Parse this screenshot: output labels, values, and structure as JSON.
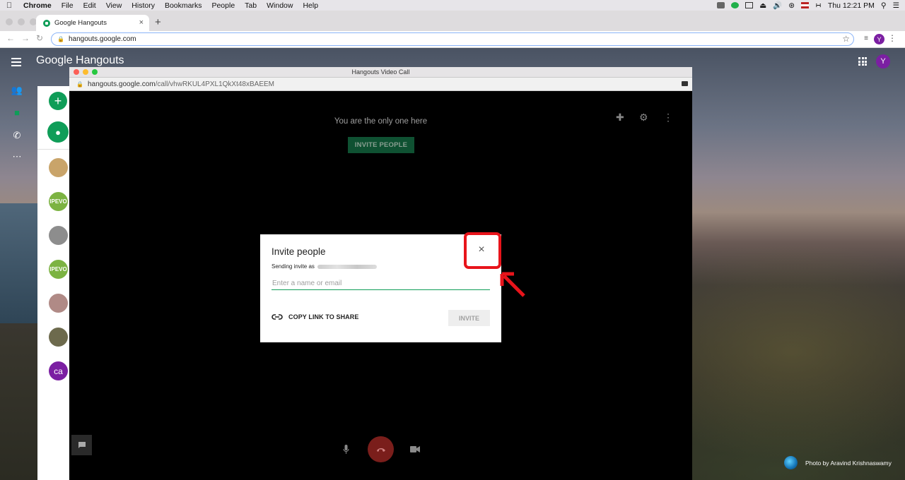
{
  "mac_menubar": {
    "app_name": "Chrome",
    "menus": [
      "File",
      "Edit",
      "View",
      "History",
      "Bookmarks",
      "People",
      "Tab",
      "Window",
      "Help"
    ],
    "clock": "Thu 12:21 PM"
  },
  "browser": {
    "tab_title": "Google Hangouts",
    "tab_close": "×",
    "new_tab": "+",
    "url": "hangouts.google.com",
    "profile_initial": "Y"
  },
  "hangouts": {
    "logo_text": "Google Hangouts",
    "account_initial": "Y",
    "new_conversation_icon": "+",
    "contacts": [
      {
        "initials": "",
        "color": "#c9a46a"
      },
      {
        "initials": "IPEVO",
        "color": "#7cb342"
      },
      {
        "initials": "",
        "color": "#8d8d8d"
      },
      {
        "initials": "IPEVO",
        "color": "#7cb342"
      },
      {
        "initials": "",
        "color": "#b08a86"
      },
      {
        "initials": "",
        "color": "#6d6a4d"
      },
      {
        "initials": "ca",
        "color": "#7b1fa2"
      }
    ]
  },
  "call_window": {
    "title": "Hangouts Video Call",
    "url_domain": "hangouts.google.com",
    "url_path": "/call/vhwRKUL4PXL1QkXt48xBAEEM",
    "status_text": "You are the only one here",
    "invite_people_button": "INVITE PEOPLE"
  },
  "invite_dialog": {
    "title": "Invite people",
    "sending_label": "Sending invite as",
    "input_placeholder": "Enter a name or email",
    "input_value": "",
    "copy_link_label": "COPY LINK TO SHARE",
    "invite_button": "INVITE",
    "close_icon": "×"
  },
  "annotation": {
    "highlight_color": "#e8141b"
  },
  "photo_credit": "Photo by Aravind Krishnaswamy"
}
